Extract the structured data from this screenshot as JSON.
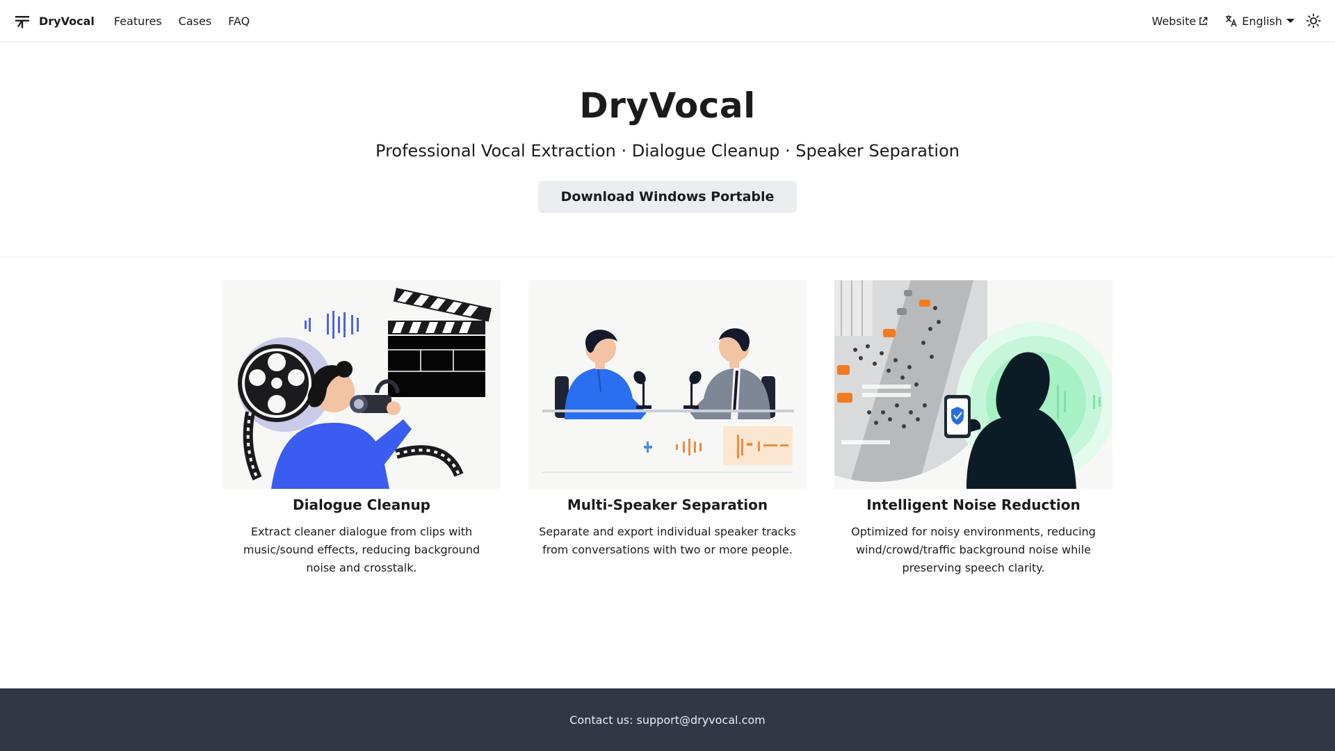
{
  "navbar": {
    "brand": "DryVocal",
    "links": [
      "Features",
      "Cases",
      "FAQ"
    ],
    "website_label": "Website",
    "language_label": "English",
    "icons": {
      "logo": "logo-icon",
      "external": "external-link-icon",
      "translate": "translate-icon",
      "theme": "sun-icon"
    }
  },
  "hero": {
    "title": "DryVocal",
    "subtitle": "Professional Vocal Extraction · Dialogue Cleanup · Speaker Separation",
    "download_label": "Download Windows Portable"
  },
  "features": [
    {
      "title": "Dialogue Cleanup",
      "description": "Extract cleaner dialogue from clips with music/sound effects, reducing background noise and crosstalk."
    },
    {
      "title": "Multi-Speaker Separation",
      "description": "Separate and export individual speaker tracks from conversations with two or more people."
    },
    {
      "title": "Intelligent Noise Reduction",
      "description": "Optimized for noisy environments, reducing wind/crowd/traffic background noise while preserving speech clarity."
    }
  ],
  "footer": {
    "contact": "Contact us: support@dryvocal.com"
  },
  "colors": {
    "footer_bg": "#303846",
    "button_bg": "#ebedf0",
    "accent_blue": "#3a5cf0",
    "accent_orange": "#f08a3a",
    "accent_green": "#7ff0b0"
  }
}
